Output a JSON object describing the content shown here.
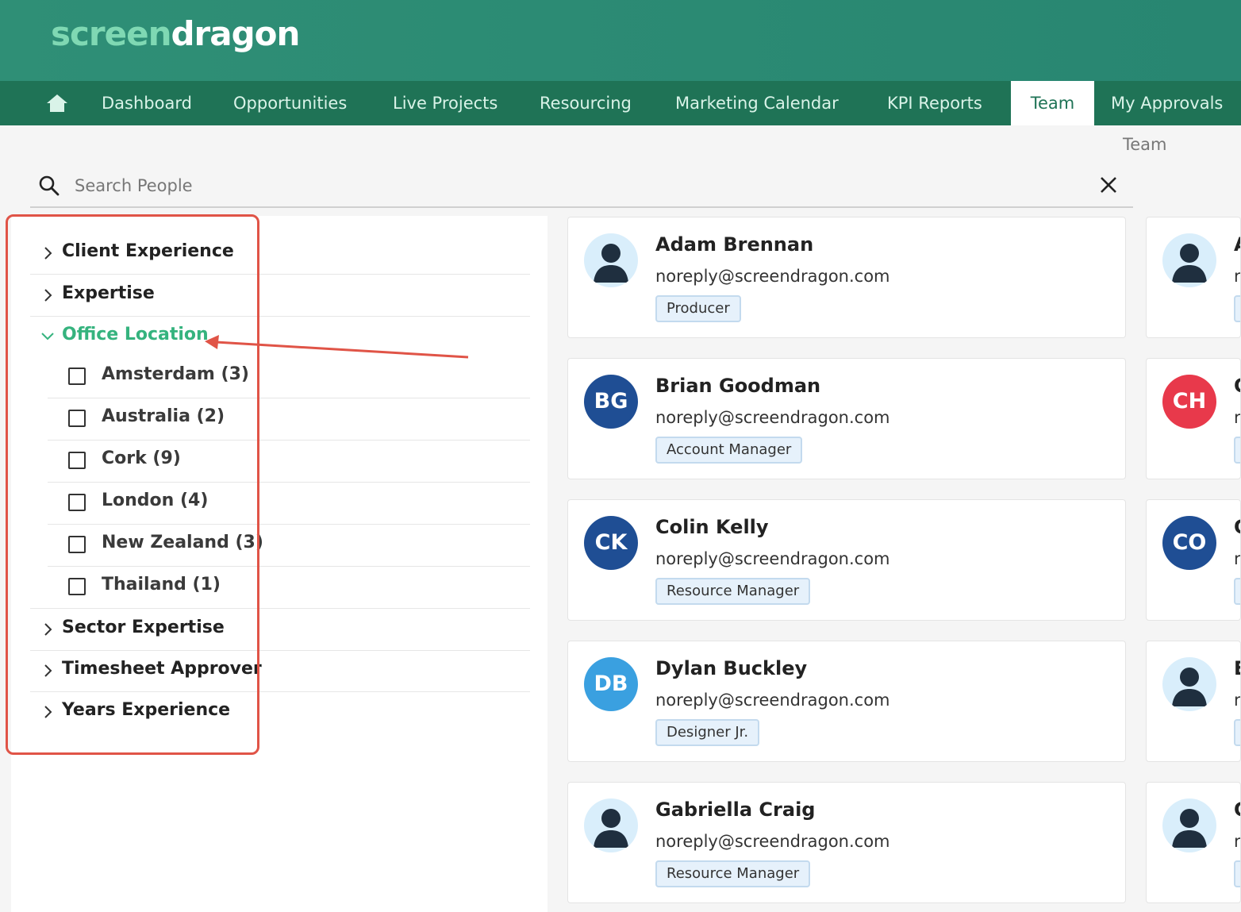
{
  "app": {
    "logo_part1": "screen",
    "logo_part2": "dragon"
  },
  "nav": {
    "home_icon": "home-icon",
    "items": [
      {
        "label": "Dashboard",
        "active": false
      },
      {
        "label": "Opportunities",
        "active": false
      },
      {
        "label": "Live Projects",
        "active": false
      },
      {
        "label": "Resourcing",
        "active": false
      },
      {
        "label": "Marketing Calendar",
        "active": false
      },
      {
        "label": "KPI Reports",
        "active": false
      },
      {
        "label": "Team",
        "active": true
      },
      {
        "label": "My Approvals",
        "active": false
      }
    ]
  },
  "breadcrumb": "Team",
  "search": {
    "placeholder": "Search People",
    "value": ""
  },
  "filters": [
    {
      "label": "Client Experience",
      "expanded": false
    },
    {
      "label": "Expertise",
      "expanded": false
    },
    {
      "label": "Office Location",
      "expanded": true,
      "options": [
        {
          "label": "Amsterdam (3)",
          "checked": false
        },
        {
          "label": "Australia (2)",
          "checked": false
        },
        {
          "label": "Cork (9)",
          "checked": false
        },
        {
          "label": "London (4)",
          "checked": false
        },
        {
          "label": "New Zealand (3)",
          "checked": false
        },
        {
          "label": "Thailand (1)",
          "checked": false
        }
      ]
    },
    {
      "label": "Sector Expertise",
      "expanded": false
    },
    {
      "label": "Timesheet Approver",
      "expanded": false
    },
    {
      "label": "Years Experience",
      "expanded": false
    }
  ],
  "people": [
    {
      "name": "Adam Brennan",
      "email": "noreply@screendragon.com",
      "role": "Producer",
      "initials": "",
      "avatar_color": "#d9eefb"
    },
    {
      "name": "Brian Goodman",
      "email": "noreply@screendragon.com",
      "role": "Account Manager",
      "initials": "BG",
      "avatar_color": "#1f4e94"
    },
    {
      "name": "Colin Kelly",
      "email": "noreply@screendragon.com",
      "role": "Resource Manager",
      "initials": "CK",
      "avatar_color": "#1f4e94"
    },
    {
      "name": "Dylan Buckley",
      "email": "noreply@screendragon.com",
      "role": "Designer Jr.",
      "initials": "DB",
      "avatar_color": "#3aa0e0"
    },
    {
      "name": "Gabriella Craig",
      "email": "noreply@screendragon.com",
      "role": "Resource Manager",
      "initials": "",
      "avatar_color": "#d9eefb"
    }
  ],
  "people_col2": [
    {
      "initials": "",
      "name_initial": "A",
      "email_frag": "r",
      "avatar_color": "#d9eefb"
    },
    {
      "initials": "CH",
      "name_initial": "C",
      "email_frag": "r",
      "avatar_color": "#e8394b"
    },
    {
      "initials": "CO",
      "name_initial": "C",
      "email_frag": "r",
      "avatar_color": "#1f4e94"
    },
    {
      "initials": "",
      "name_initial": "E",
      "email_frag": "r",
      "avatar_color": "#d9eefb"
    },
    {
      "initials": "",
      "name_initial": "C",
      "email_frag": "r",
      "avatar_color": "#d9eefb"
    }
  ],
  "colors": {
    "header": "#2f8f76",
    "nav": "#1f7356",
    "accent_green": "#35b37e",
    "annotation_red": "#e05447"
  }
}
